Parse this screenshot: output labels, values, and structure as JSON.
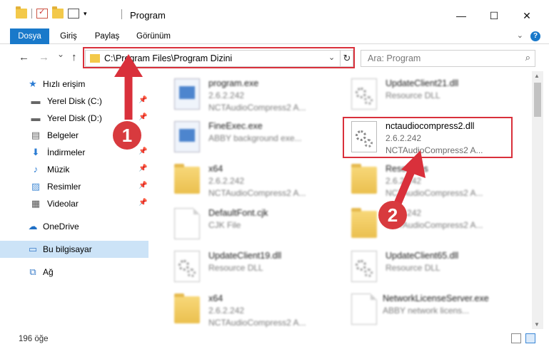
{
  "titlebar": {
    "title": "Program",
    "minimize": "—",
    "maximize": "☐",
    "close": "✕"
  },
  "ribbon": {
    "tabs": [
      "Dosya",
      "Giriş",
      "Paylaş",
      "Görünüm"
    ],
    "help": "?"
  },
  "nav": {
    "back": "←",
    "forward": "→",
    "recent": "⌄",
    "up": "↑",
    "address": "C:\\Program Files\\Program Dizini",
    "refresh": "↻",
    "search_placeholder": "Ara: Program",
    "search_icon": "⌕"
  },
  "sidebar": {
    "items": [
      {
        "label": "Hızlı erişim",
        "icon": "star-icon",
        "glyph": "★"
      },
      {
        "label": "Yerel Disk (C:)",
        "icon": "drive-icon",
        "glyph": "▬"
      },
      {
        "label": "Yerel Disk (D:)",
        "icon": "drive-icon",
        "glyph": "▬"
      },
      {
        "label": "Belgeler",
        "icon": "documents-icon",
        "glyph": "▤"
      },
      {
        "label": "İndirmeler",
        "icon": "download-icon",
        "glyph": "⬇"
      },
      {
        "label": "Müzik",
        "icon": "music-icon",
        "glyph": "♪"
      },
      {
        "label": "Resimler",
        "icon": "pictures-icon",
        "glyph": "▨"
      },
      {
        "label": "Videolar",
        "icon": "video-icon",
        "glyph": "▦"
      },
      {
        "label": "OneDrive",
        "icon": "cloud-icon",
        "glyph": "☁"
      },
      {
        "label": "Bu bilgisayar",
        "icon": "computer-icon",
        "glyph": "▭"
      },
      {
        "label": "Ağ",
        "icon": "network-icon",
        "glyph": "⧉"
      }
    ],
    "pin_glyph": "📌"
  },
  "files": [
    {
      "name": "program.exe",
      "line2": "2.6.2.242",
      "line3": "NCTAudioCompress2 A...",
      "icon": "exe-icon"
    },
    {
      "name": "UpdateClient21.dll",
      "line2": "Resource DLL",
      "line3": "",
      "icon": "dll-icon"
    },
    {
      "name": "FineExec.exe",
      "line2": "ABBY background exe...",
      "line3": "",
      "icon": "exe-icon"
    },
    {
      "name": "nctaudiocompress2.dll",
      "line2": "2.6.2.242",
      "line3": "NCTAudioCompress2 A...",
      "icon": "dll-icon"
    },
    {
      "name": "x64",
      "line2": "2.6.2.242",
      "line3": "NCTAudioCompress2 A...",
      "icon": "folder-icon"
    },
    {
      "name": "Resources",
      "line2": "2.6.2.242",
      "line3": "NCTAudioCompress2 A...",
      "icon": "folder-icon"
    },
    {
      "name": "DefaultFont.cjk",
      "line2": "CJK File",
      "line3": "",
      "icon": "document-icon"
    },
    {
      "name": "",
      "line2": "2.6.2.242",
      "line3": "NCTAudioCompress2 A...",
      "icon": "folder-icon"
    },
    {
      "name": "UpdateClient19.dll",
      "line2": "Resource DLL",
      "line3": "",
      "icon": "dll-icon"
    },
    {
      "name": "UpdateClient65.dll",
      "line2": "Resource DLL",
      "line3": "",
      "icon": "dll-icon"
    },
    {
      "name": "x64",
      "line2": "2.6.2.242",
      "line3": "NCTAudioCompress2 A...",
      "icon": "folder-icon"
    },
    {
      "name": "NetworkLicenseServer.exe",
      "line2": "ABBY network licens...",
      "line3": "",
      "icon": "document-icon"
    }
  ],
  "status": {
    "count": "196 öğe"
  },
  "annotations": {
    "badge1": "1",
    "badge2": "2",
    "color": "#d9303b"
  }
}
